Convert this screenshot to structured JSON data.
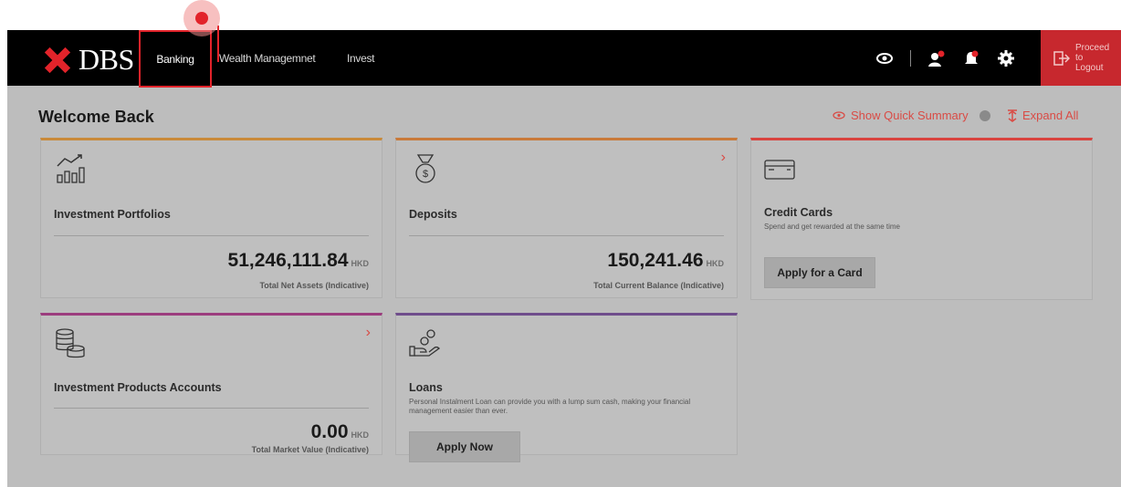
{
  "brand": {
    "name": "DBS"
  },
  "nav": {
    "items": [
      {
        "label": "Banking"
      },
      {
        "label": "Wealth Managemnet"
      },
      {
        "label": "Invest"
      }
    ]
  },
  "toolbar": {
    "icons": [
      "eye-icon",
      "user-help-icon",
      "notification-bell-icon",
      "settings-gear-icon"
    ],
    "logout_label": "Proceed to Logout"
  },
  "header": {
    "title": "Welcome Back",
    "quick_summary": "Show Quick Summary",
    "expand_all": "Expand All"
  },
  "cards": {
    "investment_portfolios": {
      "title": "Investment Portfolios",
      "amount": "51,246,111.84",
      "currency": "HKD",
      "subtitle": "Total Net Assets (Indicative)"
    },
    "deposits": {
      "title": "Deposits",
      "amount": "150,241.46",
      "currency": "HKD",
      "subtitle": "Total Current Balance (Indicative)"
    },
    "credit_cards": {
      "title": "Credit Cards",
      "description": "Spend and get rewarded at the same time",
      "button": "Apply for a Card"
    },
    "investment_products": {
      "title": "Investment Products Accounts",
      "amount": "0.00",
      "currency": "HKD",
      "subtitle": "Total Market Value (Indicative)"
    },
    "loans": {
      "title": "Loans",
      "description": "Personal Instalment Loan can provide you with a lump sum cash, making your financial management easier than ever.",
      "button": "Apply Now"
    }
  },
  "colors": {
    "brand_red": "#e2232a",
    "link_red": "#d94b45",
    "accent_orange": "#c98a3a",
    "accent_red": "#d9443f",
    "accent_magenta": "#9c3d7e",
    "accent_purple": "#6f4d8c"
  }
}
